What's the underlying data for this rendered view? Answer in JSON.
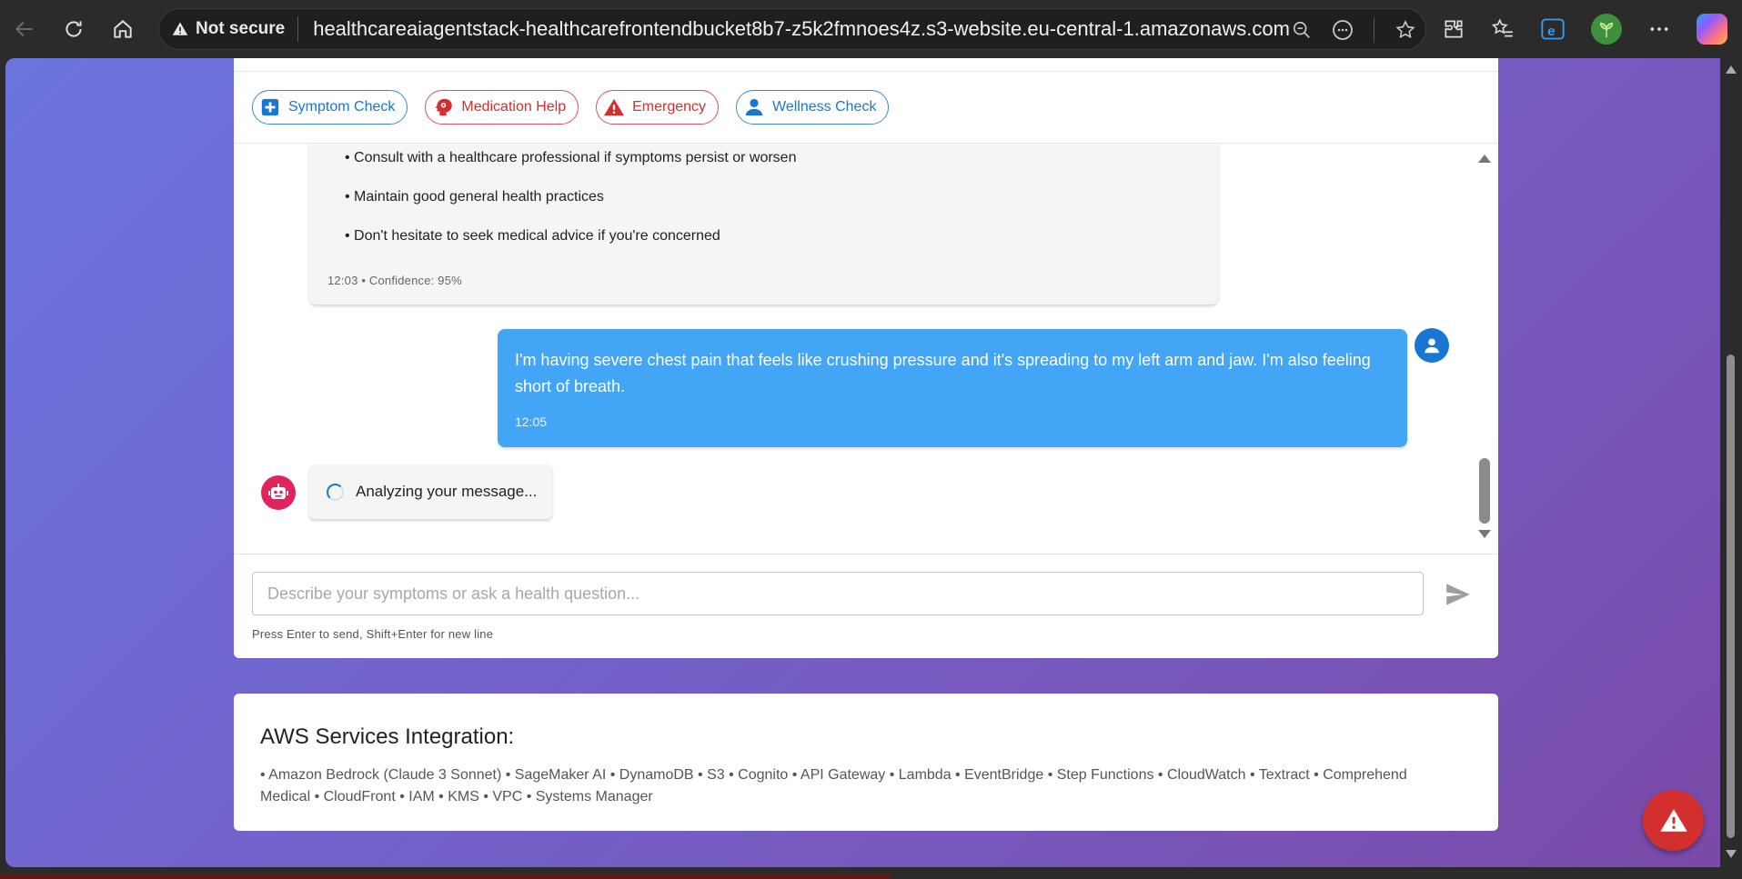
{
  "browser": {
    "security_label": "Not secure",
    "url": "healthcareaiagentstack-healthcarefrontendbucket8b7-z5k2fmnoes4z.s3-website.eu-central-1.amazonaws.com"
  },
  "quick_actions": [
    {
      "label": "Symptom Check",
      "icon": "plus-medical-icon",
      "color": "#1976d2"
    },
    {
      "label": "Medication Help",
      "icon": "psychology-head-icon",
      "color": "#d32f2f"
    },
    {
      "label": "Emergency",
      "icon": "warning-icon",
      "color": "#d32f2f"
    },
    {
      "label": "Wellness Check",
      "icon": "person-icon",
      "color": "#1976d2"
    }
  ],
  "messages": {
    "bot_previous": {
      "bullets": [
        "• Consult with a healthcare professional if symptoms persist or worsen",
        "• Maintain good general health practices",
        "• Don't hesitate to seek medical advice if you're concerned"
      ],
      "meta": "12:03 • Confidence: 95%"
    },
    "user": {
      "text": "I'm having severe chest pain that feels like crushing pressure and it's spreading to my left arm and jaw. I'm also feeling short of breath.",
      "time": "12:05"
    },
    "bot_status": "Analyzing your message..."
  },
  "composer": {
    "placeholder": "Describe your symptoms or ask a health question...",
    "hint": "Press Enter to send, Shift+Enter for new line"
  },
  "aws": {
    "title": "AWS Services Integration:",
    "services": "• Amazon Bedrock (Claude 3 Sonnet) • SageMaker AI • DynamoDB • S3 • Cognito • API Gateway • Lambda • EventBridge • Step Functions • CloudWatch • Textract • Comprehend Medical • CloudFront • IAM • KMS • VPC • Systems Manager"
  },
  "colors": {
    "primary": "#1976d2",
    "danger": "#d32f2f",
    "user_bubble": "#42a5f5",
    "bot_avatar": "#e0245e"
  }
}
